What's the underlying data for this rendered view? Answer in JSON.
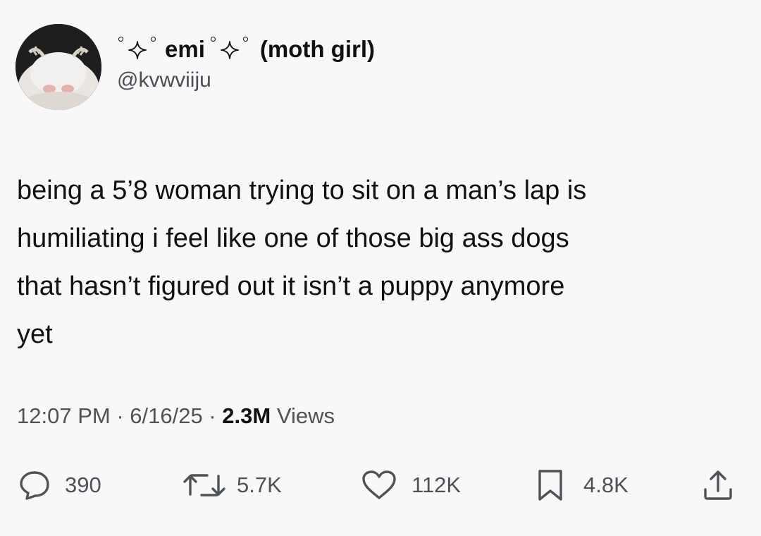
{
  "tweet": {
    "display_name": "emi",
    "display_name_suffix": "(moth girl)",
    "handle": "@kvwviiju",
    "body_lines": [
      "being a 5’8 woman trying to sit on a man’s lap is",
      "humiliating i feel like one of those big ass dogs",
      "that hasn’t figured out it isn’t a puppy anymore",
      "yet"
    ],
    "time": "12:07 PM",
    "date": "6/16/25",
    "views_count": "2.3M",
    "views_label": "Views",
    "separator": "·"
  },
  "actions": {
    "replies": "390",
    "reposts": "5.7K",
    "likes": "112K",
    "bookmarks": "4.8K"
  },
  "icons": {
    "reply": "speech-bubble-icon",
    "repost": "repost-arrows-icon",
    "like": "heart-icon",
    "bookmark": "bookmark-icon",
    "share": "share-upload-icon",
    "sparkle": "sparkle-star-icon"
  },
  "colors": {
    "background": "#f8f8f8",
    "text": "#111111",
    "muted": "#4f5358"
  }
}
